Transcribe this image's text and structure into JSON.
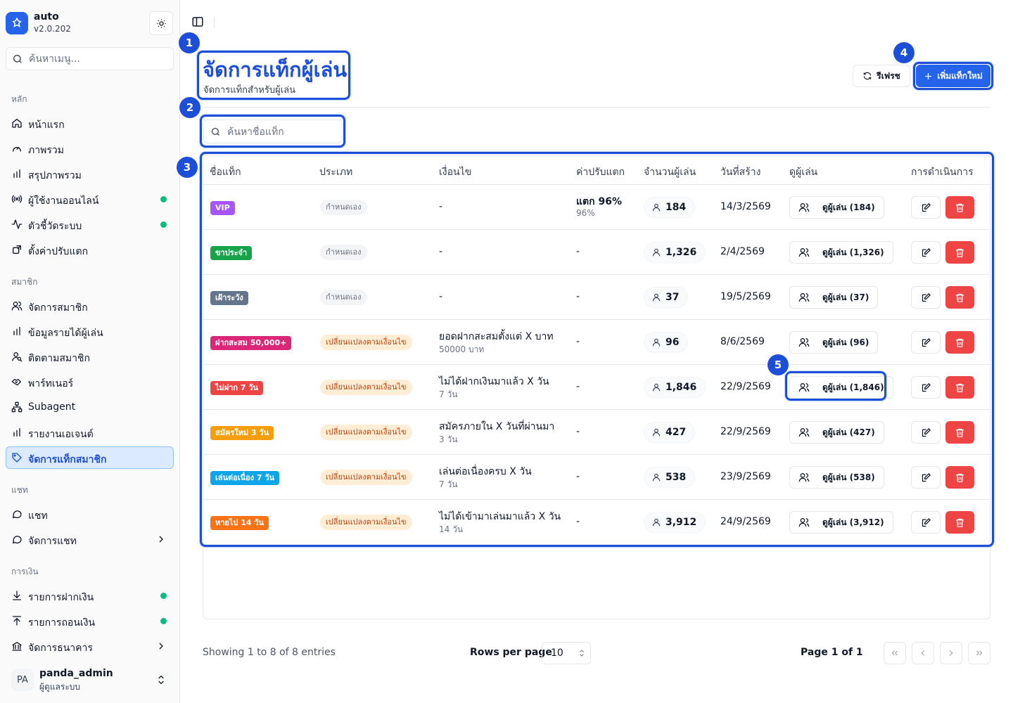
{
  "app": {
    "name": "auto",
    "version": "v2.0.202"
  },
  "sidebar": {
    "search_placeholder": "ค้นหาเมนู...",
    "groups": [
      "หลัก",
      "สมาชิก",
      "แชท",
      "การเงิน"
    ],
    "items": [
      {
        "label": "หน้าแรก",
        "icon": "home-icon"
      },
      {
        "label": "ภาพรวม",
        "icon": "gauge-icon"
      },
      {
        "label": "สรุปภาพรวม",
        "icon": "bar-chart-icon"
      },
      {
        "label": "ผู้ใช้งานออนไลน์",
        "icon": "radio-icon",
        "status_dot": true
      },
      {
        "label": "ตัวชี้วัดระบบ",
        "icon": "activity-icon",
        "status_dot": true
      },
      {
        "label": "ตั้งค่าปรับแตก",
        "icon": "settings-box-icon"
      },
      {
        "label": "จัดการสมาชิก",
        "icon": "users-icon"
      },
      {
        "label": "ข้อมูลรายได้ผู้เล่น",
        "icon": "bar-chart-icon"
      },
      {
        "label": "ติดตามสมาชิก",
        "icon": "user-search-icon"
      },
      {
        "label": "พาร์ทเนอร์",
        "icon": "handshake-icon"
      },
      {
        "label": "Subagent",
        "icon": "network-icon"
      },
      {
        "label": "รายงานเอเจนต์",
        "icon": "bar-chart-icon"
      },
      {
        "label": "จัดการแท็กสมาชิก",
        "icon": "tag-icon",
        "active": true
      },
      {
        "label": "แชท",
        "icon": "chat-icon"
      },
      {
        "label": "จัดการแชท",
        "icon": "chat-icon",
        "chevron": true
      },
      {
        "label": "รายการฝากเงิน",
        "icon": "download-icon",
        "status_dot": true
      },
      {
        "label": "รายการถอนเงิน",
        "icon": "upload-icon",
        "status_dot": true
      },
      {
        "label": "จัดการธนาคาร",
        "icon": "bank-icon",
        "chevron": true
      }
    ],
    "user": {
      "initials": "PA",
      "name": "panda_admin",
      "role": "ผู้ดูแลระบบ"
    }
  },
  "page": {
    "title": "จัดการแท็กผู้เล่น",
    "subtitle": "จัดการแท็กสำหรับผู้เล่น",
    "refresh_label": "รีเฟรช",
    "add_label": "เพิ่มแท็กใหม่",
    "search_placeholder": "ค้นหาชื่อแท็ก"
  },
  "annotations": [
    "1",
    "2",
    "3",
    "4",
    "5"
  ],
  "table": {
    "headers": [
      "ชื่อแท็ก",
      "ประเภท",
      "เงื่อนไข",
      "ค่าปรับแตก",
      "จำนวนผู้เล่น",
      "วันที่สร้าง",
      "ดูผู้เล่น",
      "การดำเนินการ"
    ],
    "rows": [
      {
        "tag": "VIP",
        "color": "#a855f7",
        "type": "กำหนดเอง",
        "type_kind": "manual",
        "cond": "-",
        "cond_sub": "",
        "pen": "แตก 96%",
        "pen_sub": "96%",
        "count": "184",
        "date": "14/3/2569",
        "view": "ดูผู้เล่น (184)"
      },
      {
        "tag": "ขาประจำ",
        "color": "#16a34a",
        "type": "กำหนดเอง",
        "type_kind": "manual",
        "cond": "-",
        "cond_sub": "",
        "pen": "-",
        "pen_sub": "",
        "count": "1,326",
        "date": "2/4/2569",
        "view": "ดูผู้เล่น (1,326)"
      },
      {
        "tag": "เฝ้าระวัง",
        "color": "#64748b",
        "type": "กำหนดเอง",
        "type_kind": "manual",
        "cond": "-",
        "cond_sub": "",
        "pen": "-",
        "pen_sub": "",
        "count": "37",
        "date": "19/5/2569",
        "view": "ดูผู้เล่น (37)"
      },
      {
        "tag": "ฝากสะสม 50,000+",
        "color": "#db2777",
        "type": "เปลี่ยนแปลงตามเงื่อนไข",
        "type_kind": "dyn",
        "cond": "ยอดฝากสะสมตั้งแต่ X บาท",
        "cond_sub": "50000 บาท",
        "pen": "-",
        "pen_sub": "",
        "count": "96",
        "date": "8/6/2569",
        "view": "ดูผู้เล่น (96)"
      },
      {
        "tag": "ไม่ฝาก 7 วัน",
        "color": "#ef4444",
        "type": "เปลี่ยนแปลงตามเงื่อนไข",
        "type_kind": "dyn",
        "cond": "ไม่ได้ฝากเงินมาแล้ว X วัน",
        "cond_sub": "7 วัน",
        "pen": "-",
        "pen_sub": "",
        "count": "1,846",
        "date": "22/9/2569",
        "view": "ดูผู้เล่น (1,846)"
      },
      {
        "tag": "สมัครใหม่ 3 วัน",
        "color": "#f59e0b",
        "type": "เปลี่ยนแปลงตามเงื่อนไข",
        "type_kind": "dyn",
        "cond": "สมัครภายใน X วันที่ผ่านมา",
        "cond_sub": "3 วัน",
        "pen": "-",
        "pen_sub": "",
        "count": "427",
        "date": "22/9/2569",
        "view": "ดูผู้เล่น (427)"
      },
      {
        "tag": "เล่นต่อเนื่อง 7 วัน",
        "color": "#0ea5e9",
        "type": "เปลี่ยนแปลงตามเงื่อนไข",
        "type_kind": "dyn",
        "cond": "เล่นต่อเนื่องครบ X วัน",
        "cond_sub": "7 วัน",
        "pen": "-",
        "pen_sub": "",
        "count": "538",
        "date": "23/9/2569",
        "view": "ดูผู้เล่น (538)"
      },
      {
        "tag": "หายไป 14 วัน",
        "color": "#f97316",
        "type": "เปลี่ยนแปลงตามเงื่อนไข",
        "type_kind": "dyn",
        "cond": "ไม่ได้เข้ามาเล่นมาแล้ว X วัน",
        "cond_sub": "14 วัน",
        "pen": "-",
        "pen_sub": "",
        "count": "3,912",
        "date": "24/9/2569",
        "view": "ดูผู้เล่น (3,912)"
      }
    ]
  },
  "pagination": {
    "showing": "Showing 1 to 8 of 8 entries",
    "rows_per_page_label": "Rows per page",
    "rows_per_page": "10",
    "page_text": "Page 1 of 1"
  }
}
